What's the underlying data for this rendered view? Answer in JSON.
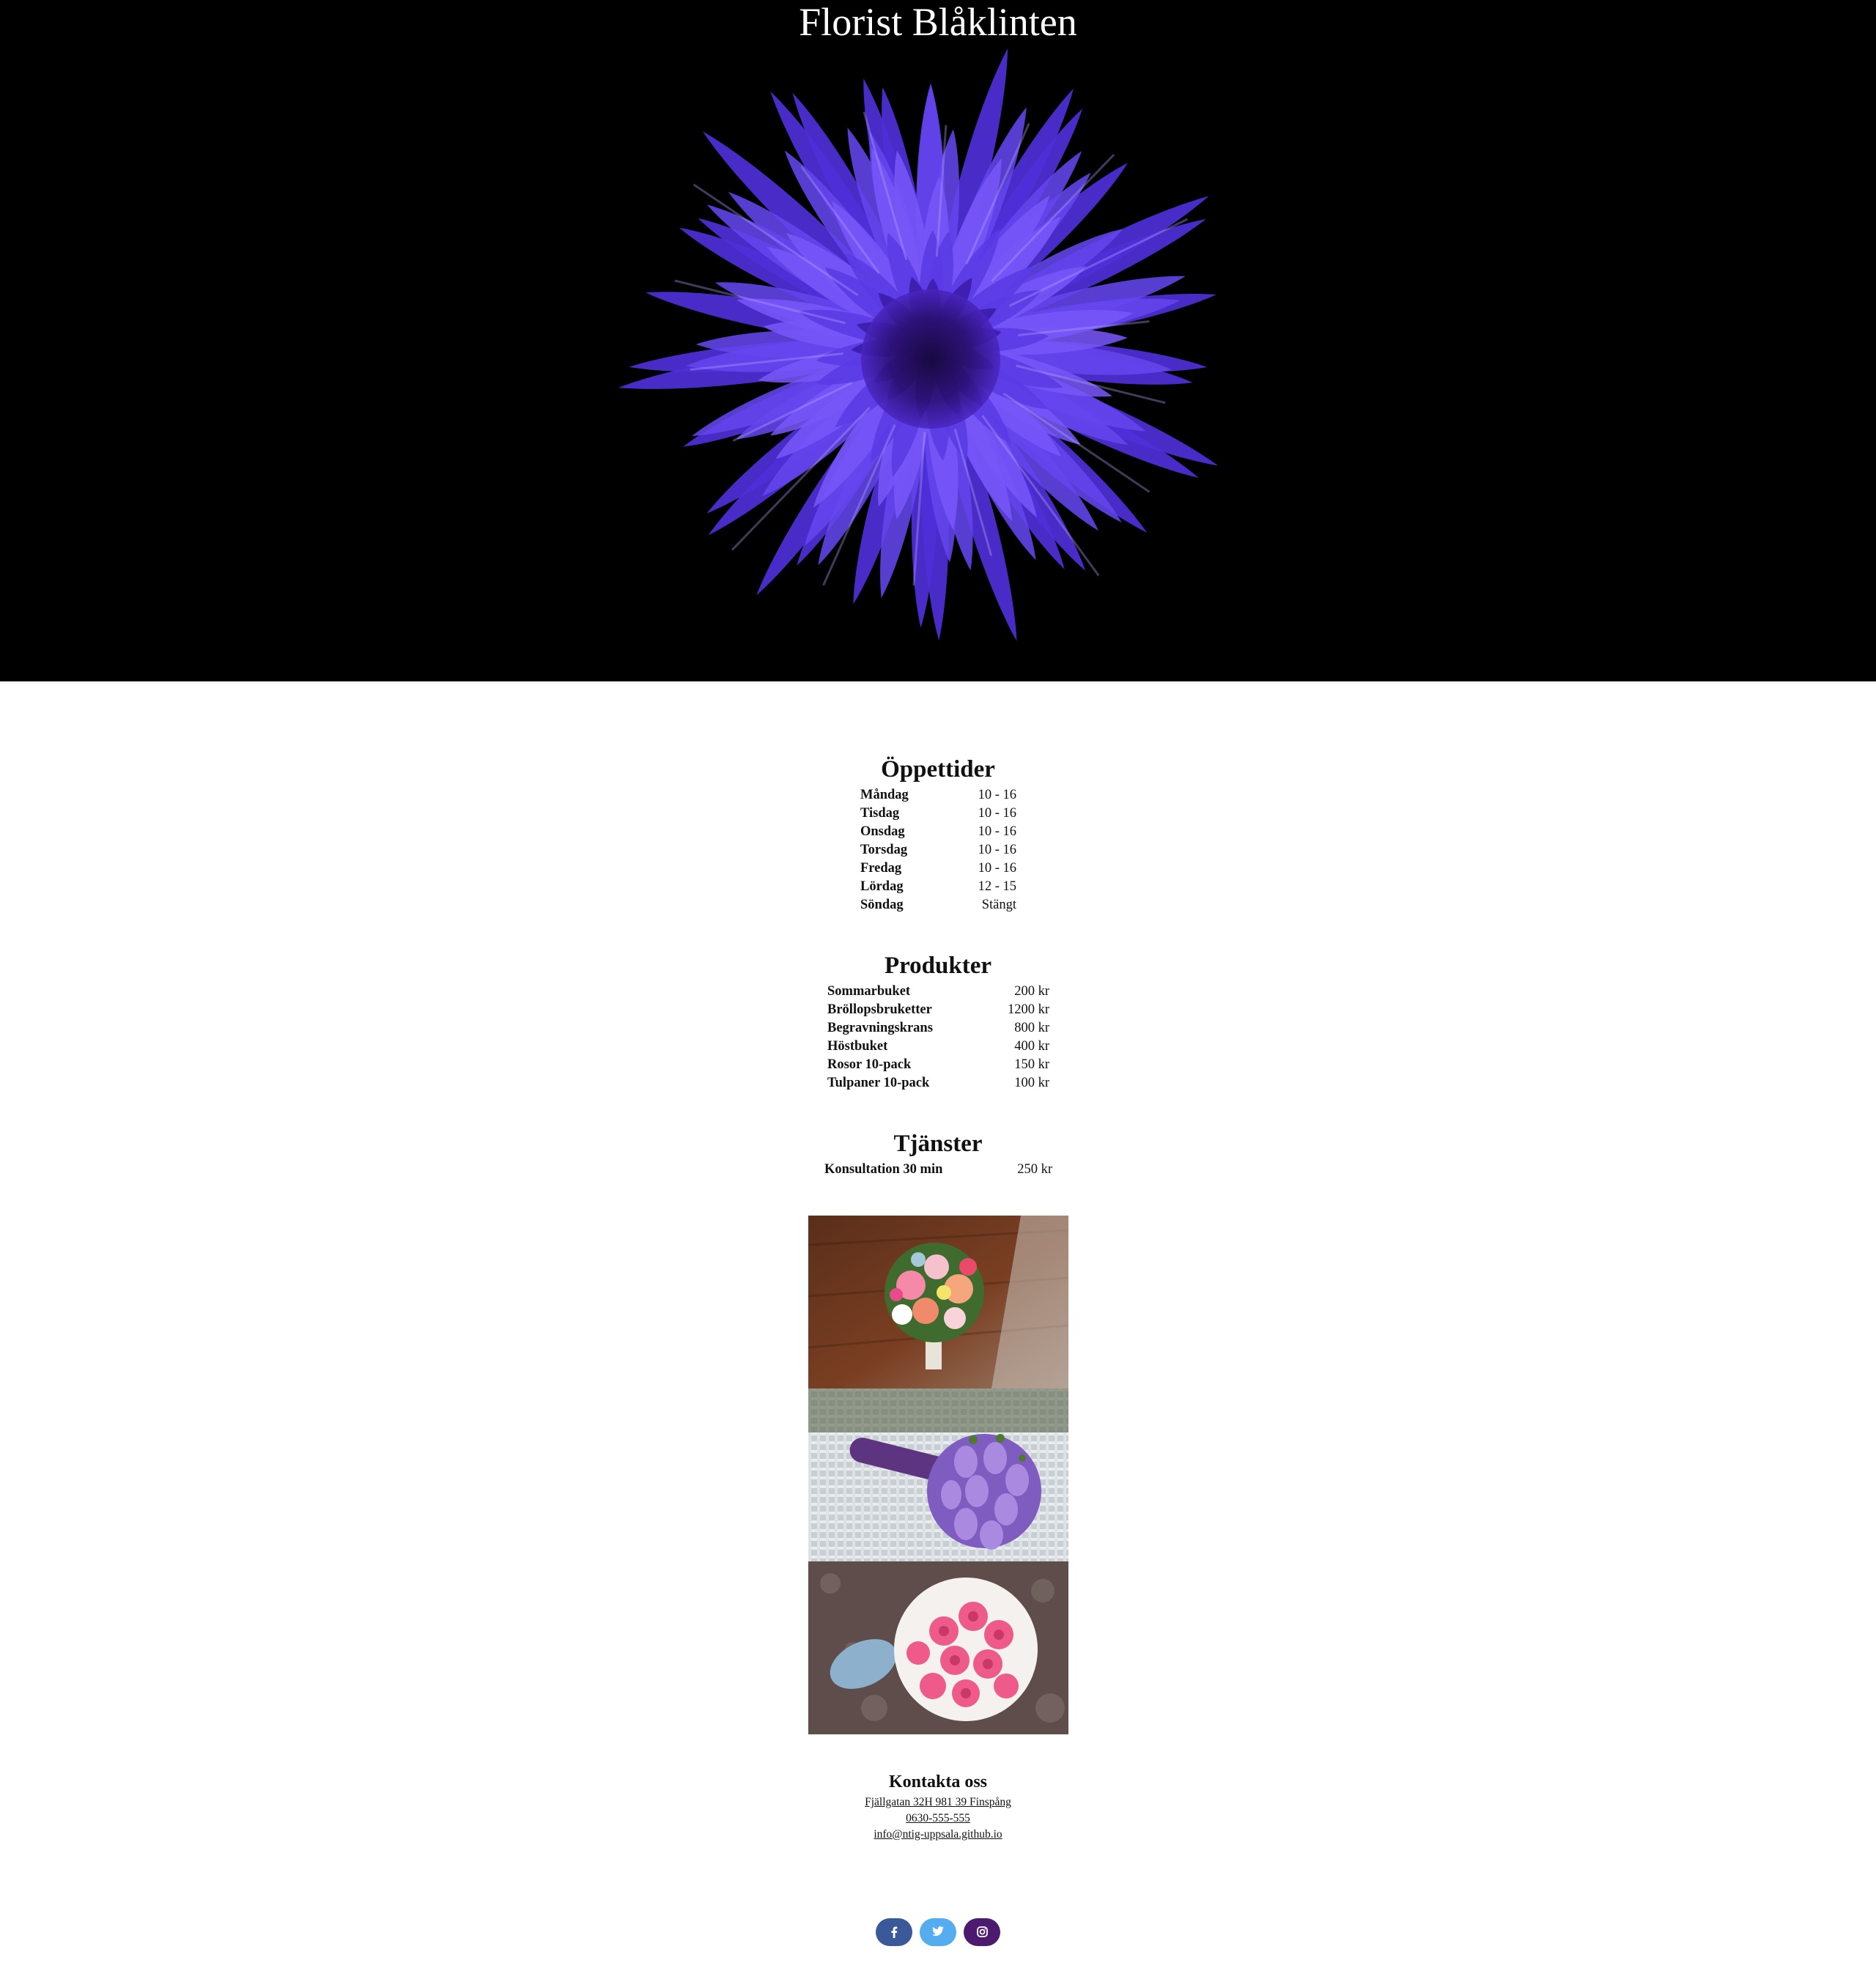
{
  "site": {
    "title": "Florist Blåklinten"
  },
  "hours": {
    "title": "Öppettider",
    "rows": [
      {
        "day": "Måndag",
        "time": "10 - 16"
      },
      {
        "day": "Tisdag",
        "time": "10 - 16"
      },
      {
        "day": "Onsdag",
        "time": "10 - 16"
      },
      {
        "day": "Torsdag",
        "time": "10 - 16"
      },
      {
        "day": "Fredag",
        "time": "10 - 16"
      },
      {
        "day": "Lördag",
        "time": "12 - 15"
      },
      {
        "day": "Söndag",
        "time": "Stängt"
      }
    ]
  },
  "products": {
    "title": "Produkter",
    "rows": [
      {
        "name": "Sommarbuket",
        "price": "200 kr"
      },
      {
        "name": "Bröllopsbruketter",
        "price": "1200 kr"
      },
      {
        "name": "Begravningskrans",
        "price": "800 kr"
      },
      {
        "name": "Höstbuket",
        "price": "400 kr"
      },
      {
        "name": "Rosor 10-pack",
        "price": "150 kr"
      },
      {
        "name": "Tulpaner 10-pack",
        "price": "100 kr"
      }
    ]
  },
  "services": {
    "title": "Tjänster",
    "rows": [
      {
        "name": "Konsultation 30 min",
        "price": "250 kr"
      }
    ]
  },
  "contact": {
    "title": "Kontakta oss",
    "address": "Fjällgatan 32H 981 39 Finspång",
    "phone": "0630-555-555",
    "email": "info@ntig-uppsala.github.io"
  },
  "social": {
    "facebook_color": "#3b5998",
    "twitter_color": "#55acee",
    "instagram_color": "#4c1a6e"
  },
  "colors": {
    "hero_bg": "#000000",
    "flower": "#5b3ef0"
  }
}
